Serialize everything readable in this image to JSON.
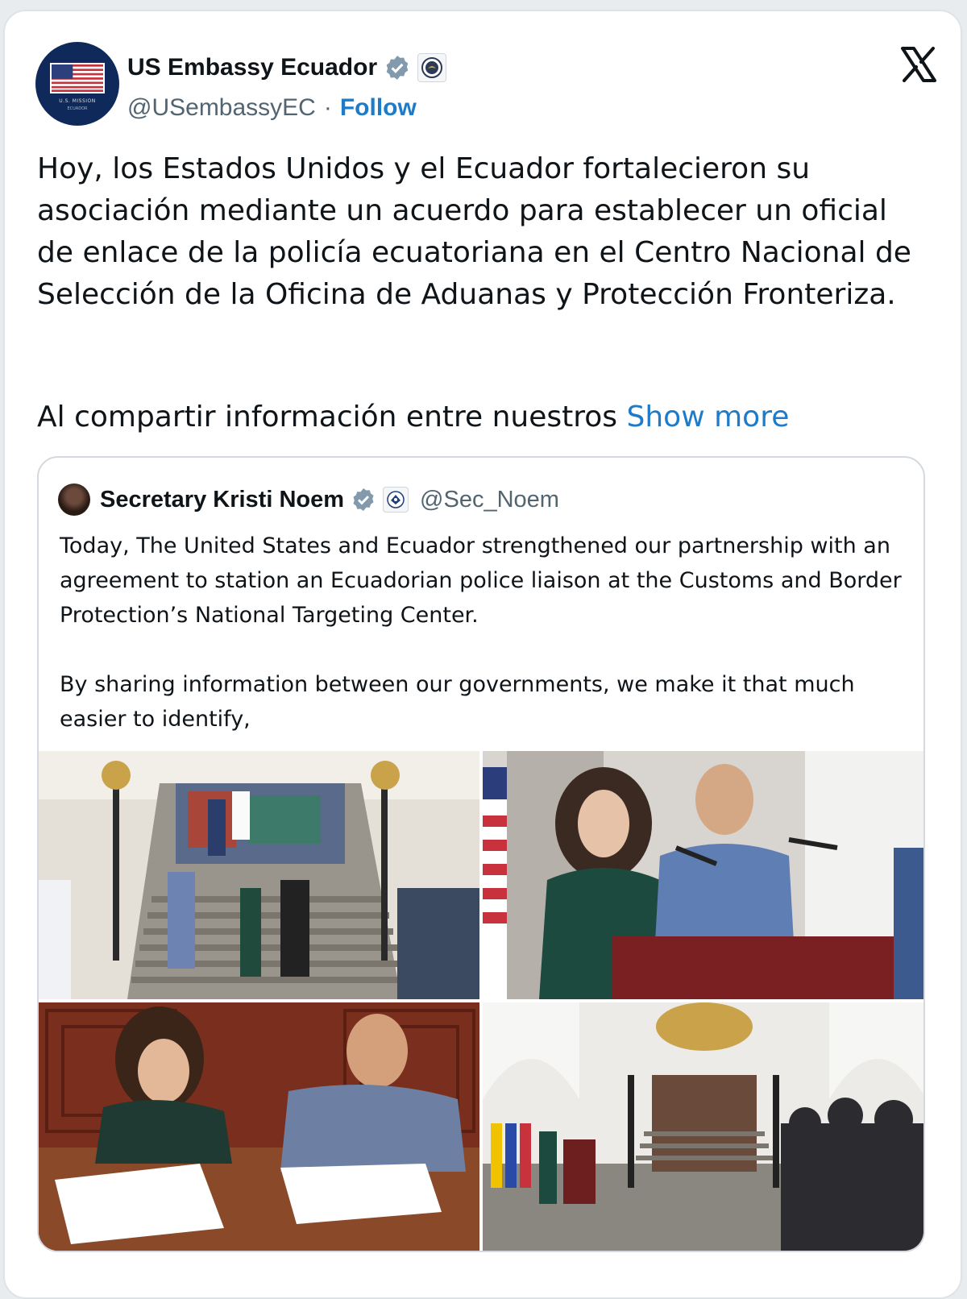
{
  "tweet": {
    "author": {
      "name": "US Embassy Ecuador",
      "handle": "@USembassyEC",
      "separator": "·",
      "follow_label": "Follow",
      "avatar_caption": [
        "U.S. MISSION",
        "ECUADOR"
      ],
      "verified_icon": "verified-badge-icon",
      "affiliation_icon": "state-department-seal-icon"
    },
    "platform_icon": "x-logo-icon",
    "text_paragraph_1": "Hoy, los Estados Unidos y el Ecuador fortalecieron su asociación mediante un acuerdo para establecer un oficial de enlace de la policía ecuatoriana en el Centro Nacional de Selección de la Oficina de Aduanas y Protección Fronteriza.",
    "text_paragraph_2": "Al compartir información entre nuestros",
    "show_more_label": "Show more"
  },
  "quoted_tweet": {
    "author": {
      "name": "Secretary Kristi Noem",
      "handle": "@Sec_Noem",
      "verified_icon": "verified-badge-icon",
      "affiliation_icon": "dhs-seal-icon"
    },
    "text_paragraph_1": "Today, The United States and Ecuador strengthened our partnership with an agreement to station an Ecuadorian police liaison at the Customs and Border Protection’s National Targeting Center.",
    "text_paragraph_2": "By sharing information between our governments, we make it that much easier to identify,",
    "photos": [
      {
        "name": "photo-officials-descending-staircase"
      },
      {
        "name": "photo-press-conference-podium"
      },
      {
        "name": "photo-signing-agreement"
      },
      {
        "name": "photo-courtyard-press-event"
      }
    ]
  },
  "colors": {
    "link": "#1d7bc9",
    "secondary_text": "#536471",
    "verified": "#829aab",
    "border": "#d3d9de"
  }
}
